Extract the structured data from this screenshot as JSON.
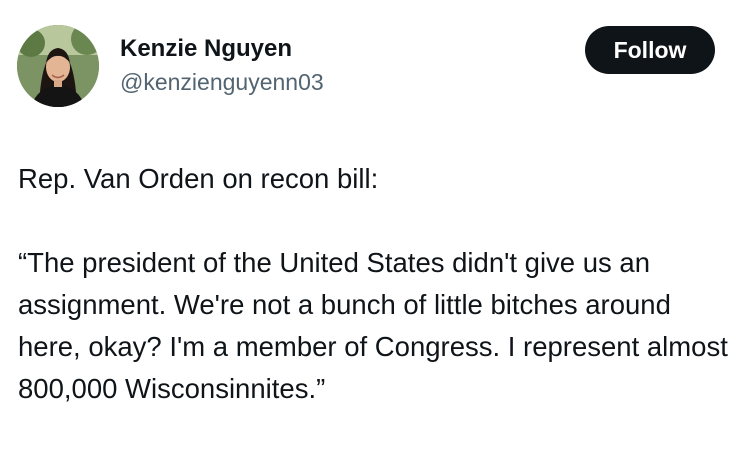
{
  "author": {
    "display_name": "Kenzie Nguyen",
    "handle": "@kenzienguyenn03",
    "avatar_icon": "profile-photo"
  },
  "actions": {
    "follow_label": "Follow"
  },
  "post": {
    "intro": "Rep. Van Orden on recon bill:",
    "quote": "“The president of the United States didn't give us an assignment. We're not a bunch of little bitches around here, okay? I'm a member of Congress. I represent almost 800,000 Wisconsinnites.”"
  },
  "colors": {
    "text_primary": "#0f1419",
    "text_secondary": "#536471",
    "button_bg": "#0f1419",
    "button_text": "#ffffff"
  }
}
